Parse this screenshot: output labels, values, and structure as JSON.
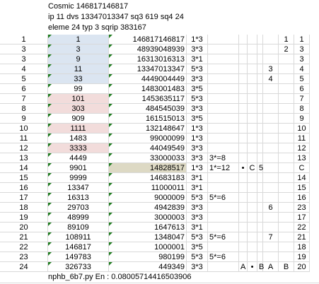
{
  "header": {
    "line1": "Cosmic 146817146817",
    "line2": "ip 11 dvs 13347013347 sq3 619 sq4 24",
    "line3": "eleme 24 typ 3 sqrip 383167"
  },
  "rows": [
    {
      "n": "1",
      "a": "1",
      "b": "146817146817",
      "c": "1*3",
      "d": "",
      "e": "",
      "f": "",
      "g": "",
      "h": "",
      "i": "",
      "j": "1",
      "k": "1",
      "m": "1"
    },
    {
      "n": "3",
      "a": "3",
      "b": "48939048939",
      "c": "3*3",
      "d": "",
      "e": "",
      "f": "",
      "g": "",
      "h": "",
      "i": "",
      "j": "2",
      "k": "2",
      "m": "3"
    },
    {
      "n": "3",
      "a": "9",
      "b": "16313016313",
      "c": "3*1",
      "d": "",
      "e": "",
      "f": "",
      "g": "",
      "h": "",
      "i": "",
      "j": "",
      "k": "",
      "m": "3"
    },
    {
      "n": "4",
      "a": "11",
      "b": "13347013347",
      "c": "5*3",
      "d": "",
      "e": "",
      "f": "",
      "g": "",
      "h": "",
      "i": "3",
      "j": "",
      "k": "",
      "m": "4"
    },
    {
      "n": "5",
      "a": "33",
      "b": "4449004449",
      "c": "3*3",
      "d": "",
      "e": "",
      "f": "",
      "g": "",
      "h": "",
      "i": "4",
      "j": "",
      "k": "",
      "m": "5"
    },
    {
      "n": "6",
      "a": "99",
      "b": "1483001483",
      "c": "3*5",
      "d": "",
      "e": "",
      "f": "",
      "g": "",
      "h": "",
      "i": "",
      "j": "",
      "k": "",
      "m": "6"
    },
    {
      "n": "7",
      "a": "101",
      "b": "1453635117",
      "c": "5*3",
      "d": "",
      "e": "",
      "f": "",
      "g": "",
      "h": "",
      "i": "",
      "j": "",
      "k": "3",
      "m": "7"
    },
    {
      "n": "8",
      "a": "303",
      "b": "484545039",
      "c": "3*3",
      "d": "",
      "e": "",
      "f": "",
      "g": "",
      "h": "",
      "i": "",
      "j": "",
      "k": "4",
      "m": "8"
    },
    {
      "n": "9",
      "a": "909",
      "b": "161515013",
      "c": "3*5",
      "d": "",
      "e": "",
      "f": "",
      "g": "",
      "h": "",
      "i": "",
      "j": "",
      "k": "",
      "m": "9"
    },
    {
      "n": "10",
      "a": "1111",
      "b": "132148647",
      "c": "1*3",
      "d": "",
      "e": "",
      "f": "",
      "g": "",
      "h": "",
      "i": "",
      "j": "",
      "k": "",
      "m": "10"
    },
    {
      "n": "11",
      "a": "1483",
      "b": "99000099",
      "c": "1*3",
      "d": "",
      "e": "",
      "f": "",
      "g": "",
      "h": "",
      "i": "",
      "j": "",
      "k": "5",
      "m": "11"
    },
    {
      "n": "12",
      "a": "3333",
      "b": "44049549",
      "c": "3*3",
      "d": "",
      "e": "",
      "f": "",
      "g": "",
      "h": "",
      "i": "",
      "j": "",
      "k": "",
      "m": "12"
    },
    {
      "n": "13",
      "a": "4449",
      "b": "33000033",
      "c": "3*3",
      "d": "3*=8",
      "e": "",
      "f": "",
      "g": "",
      "h": "",
      "i": "",
      "j": "",
      "k": "6",
      "m": "13"
    },
    {
      "n": "14",
      "a": "9901",
      "b": "14828517",
      "c": "1*3",
      "d": "1*=12",
      "e": "•",
      "f": "C",
      "g": "5",
      "h": "",
      "i": "",
      "j": "",
      "k": "",
      "m": "C"
    },
    {
      "n": "15",
      "a": "9999",
      "b": "14683183",
      "c": "3*1",
      "d": "",
      "e": "",
      "f": "",
      "g": "",
      "h": "",
      "i": "",
      "j": "",
      "k": "",
      "m": "14"
    },
    {
      "n": "16",
      "a": "13347",
      "b": "11000011",
      "c": "3*1",
      "d": "",
      "e": "",
      "f": "",
      "g": "",
      "h": "",
      "i": "",
      "j": "",
      "k": "",
      "m": "15"
    },
    {
      "n": "17",
      "a": "16313",
      "b": "9000009",
      "c": "5*3",
      "d": "5*=6",
      "e": "",
      "f": "",
      "g": "",
      "h": "",
      "i": "",
      "j": "",
      "k": "",
      "m": "16"
    },
    {
      "n": "18",
      "a": "29703",
      "b": "4942839",
      "c": "3*3",
      "d": "",
      "e": "",
      "f": "",
      "g": "",
      "h": "",
      "i": "6",
      "j": "",
      "k": "",
      "m": "23"
    },
    {
      "n": "19",
      "a": "48999",
      "b": "3000003",
      "c": "3*3",
      "d": "",
      "e": "",
      "f": "",
      "g": "",
      "h": "",
      "i": "",
      "j": "",
      "k": "",
      "m": "17"
    },
    {
      "n": "20",
      "a": "89109",
      "b": "1647613",
      "c": "3*1",
      "d": "",
      "e": "",
      "f": "",
      "g": "",
      "h": "",
      "i": "",
      "j": "",
      "k": "",
      "m": "22"
    },
    {
      "n": "21",
      "a": "108911",
      "b": "1348047",
      "c": "5*3",
      "d": "5*=6",
      "e": "",
      "f": "",
      "g": "",
      "h": "",
      "i": "7",
      "j": "",
      "k": "",
      "m": "21"
    },
    {
      "n": "22",
      "a": "146817",
      "b": "1000001",
      "c": "3*5",
      "d": "",
      "e": "",
      "f": "",
      "g": "",
      "h": "",
      "i": "",
      "j": "",
      "k": "",
      "m": "18"
    },
    {
      "n": "23",
      "a": "149783",
      "b": "980199",
      "c": "5*3",
      "d": "5*=6",
      "e": "",
      "f": "",
      "g": "",
      "h": "",
      "i": "",
      "j": "",
      "k": "7",
      "m": "19"
    },
    {
      "n": "24",
      "a": "326733",
      "b": "449349",
      "c": "3*3",
      "d": "",
      "e": "A",
      "f": "•",
      "g": "B",
      "h": "",
      "i": "A",
      "j": "B",
      "k": "",
      "m": "20"
    }
  ],
  "footer": "nphb_6b7.py En : 0.0800571441650390​6"
}
